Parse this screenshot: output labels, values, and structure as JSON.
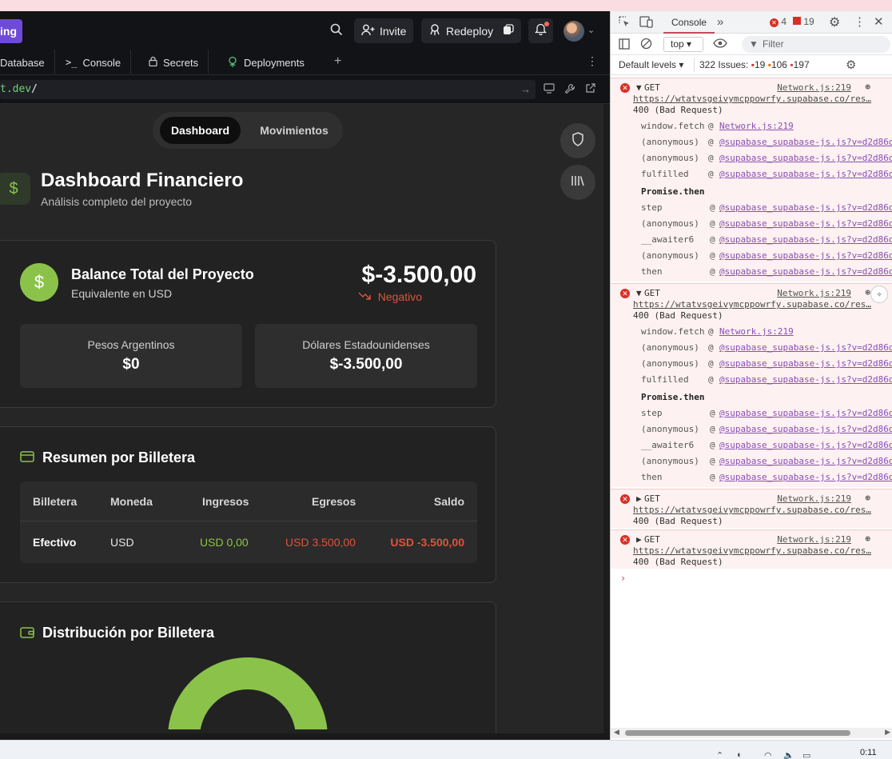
{
  "topbar": {
    "brand_label": "ing",
    "invite_label": "Invite",
    "redeploy_label": "Redeploy"
  },
  "tabs": [
    {
      "label": "Database"
    },
    {
      "label": "Console"
    },
    {
      "label": "Secrets"
    },
    {
      "label": "Deployments"
    }
  ],
  "url": {
    "host": "t.dev",
    "path": "/"
  },
  "segment": {
    "active": "Dashboard",
    "other": "Movimientos"
  },
  "header": {
    "title": "Dashboard Financiero",
    "subtitle": "Análisis completo del proyecto"
  },
  "balance": {
    "title": "Balance Total del Proyecto",
    "subtitle": "Equivalente en USD",
    "amount": "$-3.500,00",
    "trend": "Negativo",
    "pesos_label": "Pesos Argentinos",
    "pesos_value": "$0",
    "usd_label": "Dólares Estadounidenses",
    "usd_value": "$-3.500,00"
  },
  "wallet_summary": {
    "title": "Resumen por Billetera",
    "headers": [
      "Billetera",
      "Moneda",
      "Ingresos",
      "Egresos",
      "Saldo"
    ],
    "rows": [
      {
        "wallet": "Efectivo",
        "currency": "USD",
        "income": "USD 0,00",
        "expense": "USD 3.500,00",
        "balance": "USD -3.500,00"
      }
    ]
  },
  "distribution": {
    "title": "Distribución por Billetera"
  },
  "colors": {
    "accent": "#8bc34a",
    "negative": "#e0533d",
    "brand": "#6f4ad8"
  },
  "devtools": {
    "tab_console": "Console",
    "error_count": "4",
    "issue_count_badge": "19",
    "context": "top",
    "filter_placeholder": "Filter",
    "default_levels": "Default levels",
    "issues_label": "322 Issues:",
    "issues_errors": "19",
    "issues_warnings": "106",
    "issues_info": "197",
    "entries": [
      {
        "method": "GET",
        "source": "Network.js:219",
        "url": "https://wtatvsgeivymcppowrfy.supabase.co/res…",
        "status": "400 (Bad Request)",
        "expanded": true
      },
      {
        "method": "GET",
        "source": "Network.js:219",
        "url": "https://wtatvsgeivymcppowrfy.supabase.co/res…",
        "status": "400 (Bad Request)",
        "expanded": true
      },
      {
        "method": "GET",
        "source": "Network.js:219",
        "url": "https://wtatvsgeivymcppowrfy.supabase.co/res…",
        "status": "400 (Bad Request)",
        "expanded": false
      },
      {
        "method": "GET",
        "source": "Network.js:219",
        "url": "https://wtatvsgeivymcppowrfy.supabase.co/res…",
        "status": "400 (Bad Request)",
        "expanded": false
      }
    ],
    "stack": [
      {
        "fn": "window.fetch",
        "at": "@",
        "file": "Network.js:219"
      },
      {
        "fn": "(anonymous)",
        "at": "@",
        "file": "@supabase_supabase-js.js?v=d2d86d"
      },
      {
        "fn": "(anonymous)",
        "at": "@",
        "file": "@supabase_supabase-js.js?v=d2d86d"
      },
      {
        "fn": "fulfilled",
        "at": "@",
        "file": "@supabase_supabase-js.js?v=d2d86d"
      },
      {
        "fn": "Promise.then",
        "at": "",
        "file": ""
      },
      {
        "fn": "step",
        "at": "@",
        "file": "@supabase_supabase-js.js?v=d2d86d"
      },
      {
        "fn": "(anonymous)",
        "at": "@",
        "file": "@supabase_supabase-js.js?v=d2d86d"
      },
      {
        "fn": "__awaiter6",
        "at": "@",
        "file": "@supabase_supabase-js.js?v=d2d86d"
      },
      {
        "fn": "(anonymous)",
        "at": "@",
        "file": "@supabase_supabase-js.js?v=d2d86d"
      },
      {
        "fn": "then",
        "at": "@",
        "file": "@supabase_supabase-js.js?v=d2d86d"
      }
    ]
  },
  "taskbar": {
    "time": "0:11"
  }
}
